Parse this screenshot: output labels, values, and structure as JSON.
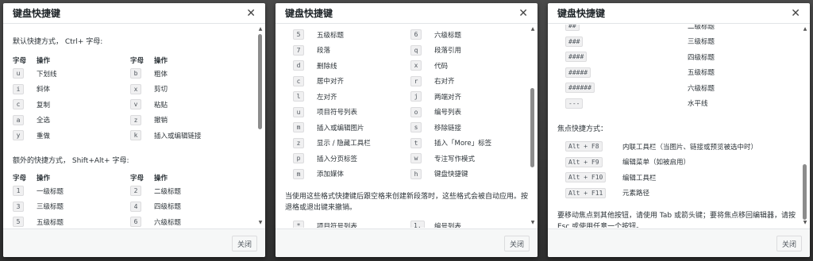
{
  "common": {
    "title": "键盘快捷键",
    "close_button": "关闭"
  },
  "dialog1": {
    "section1_title": "默认快捷方式， Ctrl+ 字母:",
    "headers": {
      "key": "字母",
      "action": "操作"
    },
    "rows1": [
      {
        "k1": "u",
        "a1": "下划线",
        "k2": "b",
        "a2": "粗体"
      },
      {
        "k1": "i",
        "a1": "斜体",
        "k2": "x",
        "a2": "剪切"
      },
      {
        "k1": "c",
        "a1": "复制",
        "k2": "v",
        "a2": "粘贴"
      },
      {
        "k1": "a",
        "a1": "全选",
        "k2": "z",
        "a2": "撤销"
      },
      {
        "k1": "y",
        "a1": "重做",
        "k2": "k",
        "a2": "插入或编辑链接"
      }
    ],
    "section2_title": "额外的快捷方式， Shift+Alt+ 字母:",
    "rows2": [
      {
        "k1": "1",
        "a1": "一级标题",
        "k2": "2",
        "a2": "二级标题"
      },
      {
        "k1": "3",
        "a1": "三级标题",
        "k2": "4",
        "a2": "四级标题"
      },
      {
        "k1": "5",
        "a1": "五级标题",
        "k2": "6",
        "a2": "六级标题"
      }
    ]
  },
  "dialog2": {
    "rows": [
      {
        "k1": "5",
        "a1": "五级标题",
        "k2": "6",
        "a2": "六级标题"
      },
      {
        "k1": "7",
        "a1": "段落",
        "k2": "q",
        "a2": "段落引用"
      },
      {
        "k1": "d",
        "a1": "删除线",
        "k2": "x",
        "a2": "代码"
      },
      {
        "k1": "c",
        "a1": "居中对齐",
        "k2": "r",
        "a2": "右对齐"
      },
      {
        "k1": "l",
        "a1": "左对齐",
        "k2": "j",
        "a2": "两端对齐"
      },
      {
        "k1": "u",
        "a1": "项目符号列表",
        "k2": "o",
        "a2": "编号列表"
      },
      {
        "k1": "m",
        "a1": "插入或编辑图片",
        "k2": "s",
        "a2": "移除链接"
      },
      {
        "k1": "z",
        "a1": "显示 / 隐藏工具栏",
        "k2": "t",
        "a2": "插入「More」标签"
      },
      {
        "k1": "p",
        "a1": "插入分页标签",
        "k2": "w",
        "a2": "专注写作模式"
      },
      {
        "k1": "m",
        "a1": "添加媒体",
        "k2": "h",
        "a2": "键盘快捷键"
      }
    ],
    "note": "当使用这些格式快捷键后跟空格来创建新段落时，这些格式会被自动应用。按退格或退出键来撤销。",
    "format_row": {
      "k1": "*",
      "a1": "项目符号列表",
      "k2": "1.",
      "a2": "编号列表"
    }
  },
  "dialog3": {
    "partial_top": {
      "k": "##",
      "a": "二级标题"
    },
    "rows": [
      {
        "k": "###",
        "a": "三级标题"
      },
      {
        "k": "####",
        "a": "四级标题"
      },
      {
        "k": "#####",
        "a": "五级标题"
      },
      {
        "k": "######",
        "a": "六级标题"
      },
      {
        "k": "---",
        "a": "水平线"
      }
    ],
    "focus_title": "焦点快捷方式：",
    "focus_rows": [
      {
        "k": "Alt + F8",
        "a": "内联工具栏（当图片、链接或预览被选中时）"
      },
      {
        "k": "Alt + F9",
        "a": "编辑菜单（如被启用）"
      },
      {
        "k": "Alt + F10",
        "a": "编辑工具栏"
      },
      {
        "k": "Alt + F11",
        "a": "元素路径"
      }
    ],
    "note": "要移动焦点到其他按钮，请使用 Tab 或箭头键；要将焦点移回编辑器，请按 Esc 或使用任意一个按钮。"
  },
  "scroll_positions": {
    "dialog1": 0.0,
    "dialog2": 0.45,
    "dialog3": 0.95
  }
}
